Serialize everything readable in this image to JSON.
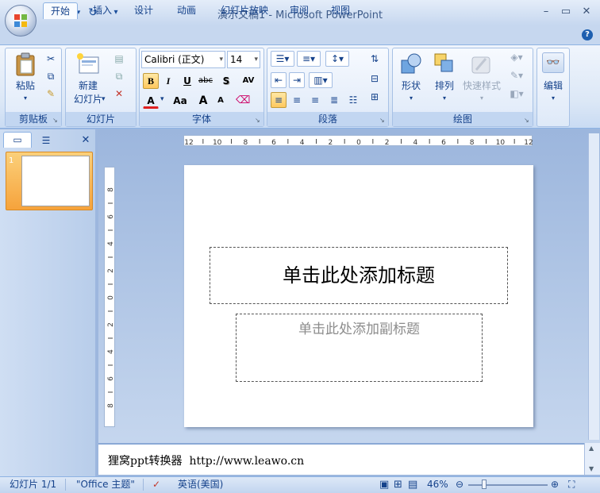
{
  "window": {
    "title": "演示文稿1 - Microsoft PowerPoint",
    "minimize_icon": "minimize-icon",
    "restore_icon": "restore-icon",
    "close_icon": "close-icon"
  },
  "quick_access": {
    "save_icon": "save-icon",
    "undo_icon": "undo-icon",
    "redo_icon": "redo-icon",
    "customize_icon": "chevron-down-icon"
  },
  "tabs": [
    {
      "label": "开始",
      "active": true
    },
    {
      "label": "插入"
    },
    {
      "label": "设计"
    },
    {
      "label": "动画"
    },
    {
      "label": "幻灯片放映"
    },
    {
      "label": "审阅"
    },
    {
      "label": "视图"
    }
  ],
  "ribbon": {
    "clipboard": {
      "label": "剪贴板",
      "paste": "粘贴"
    },
    "slides": {
      "label": "幻灯片",
      "new_slide_line1": "新建",
      "new_slide_line2": "幻灯片"
    },
    "font": {
      "label": "字体",
      "font_name": "Calibri (正文)",
      "font_size": "14",
      "bold": "B",
      "italic": "I",
      "underline": "U",
      "strike": "abc",
      "shadow": "S",
      "spacing": "AV",
      "color": "A",
      "change_case": "Aa",
      "grow": "A",
      "shrink": "A"
    },
    "paragraph": {
      "label": "段落"
    },
    "drawing": {
      "label": "绘图",
      "shapes": "形状",
      "arrange": "排列",
      "quick_styles": "快速样式"
    },
    "editing": {
      "label": "编辑"
    }
  },
  "slide": {
    "number": "1",
    "title_placeholder": "单击此处添加标题",
    "subtitle_placeholder": "单击此处添加副标题"
  },
  "rulers": {
    "horizontal": [
      "12",
      "10",
      "8",
      "6",
      "4",
      "2",
      "0",
      "2",
      "4",
      "6",
      "8",
      "10",
      "12"
    ],
    "vertical": [
      "8",
      "6",
      "4",
      "2",
      "0",
      "2",
      "4",
      "6",
      "8"
    ]
  },
  "notes": {
    "text": "狸窝ppt转换器  http://www.leawo.cn"
  },
  "status": {
    "slide_counter": "幻灯片 1/1",
    "theme": "\"Office 主题\"",
    "language": "英语(美国)",
    "zoom": "46%",
    "zoom_level": 0.46
  }
}
